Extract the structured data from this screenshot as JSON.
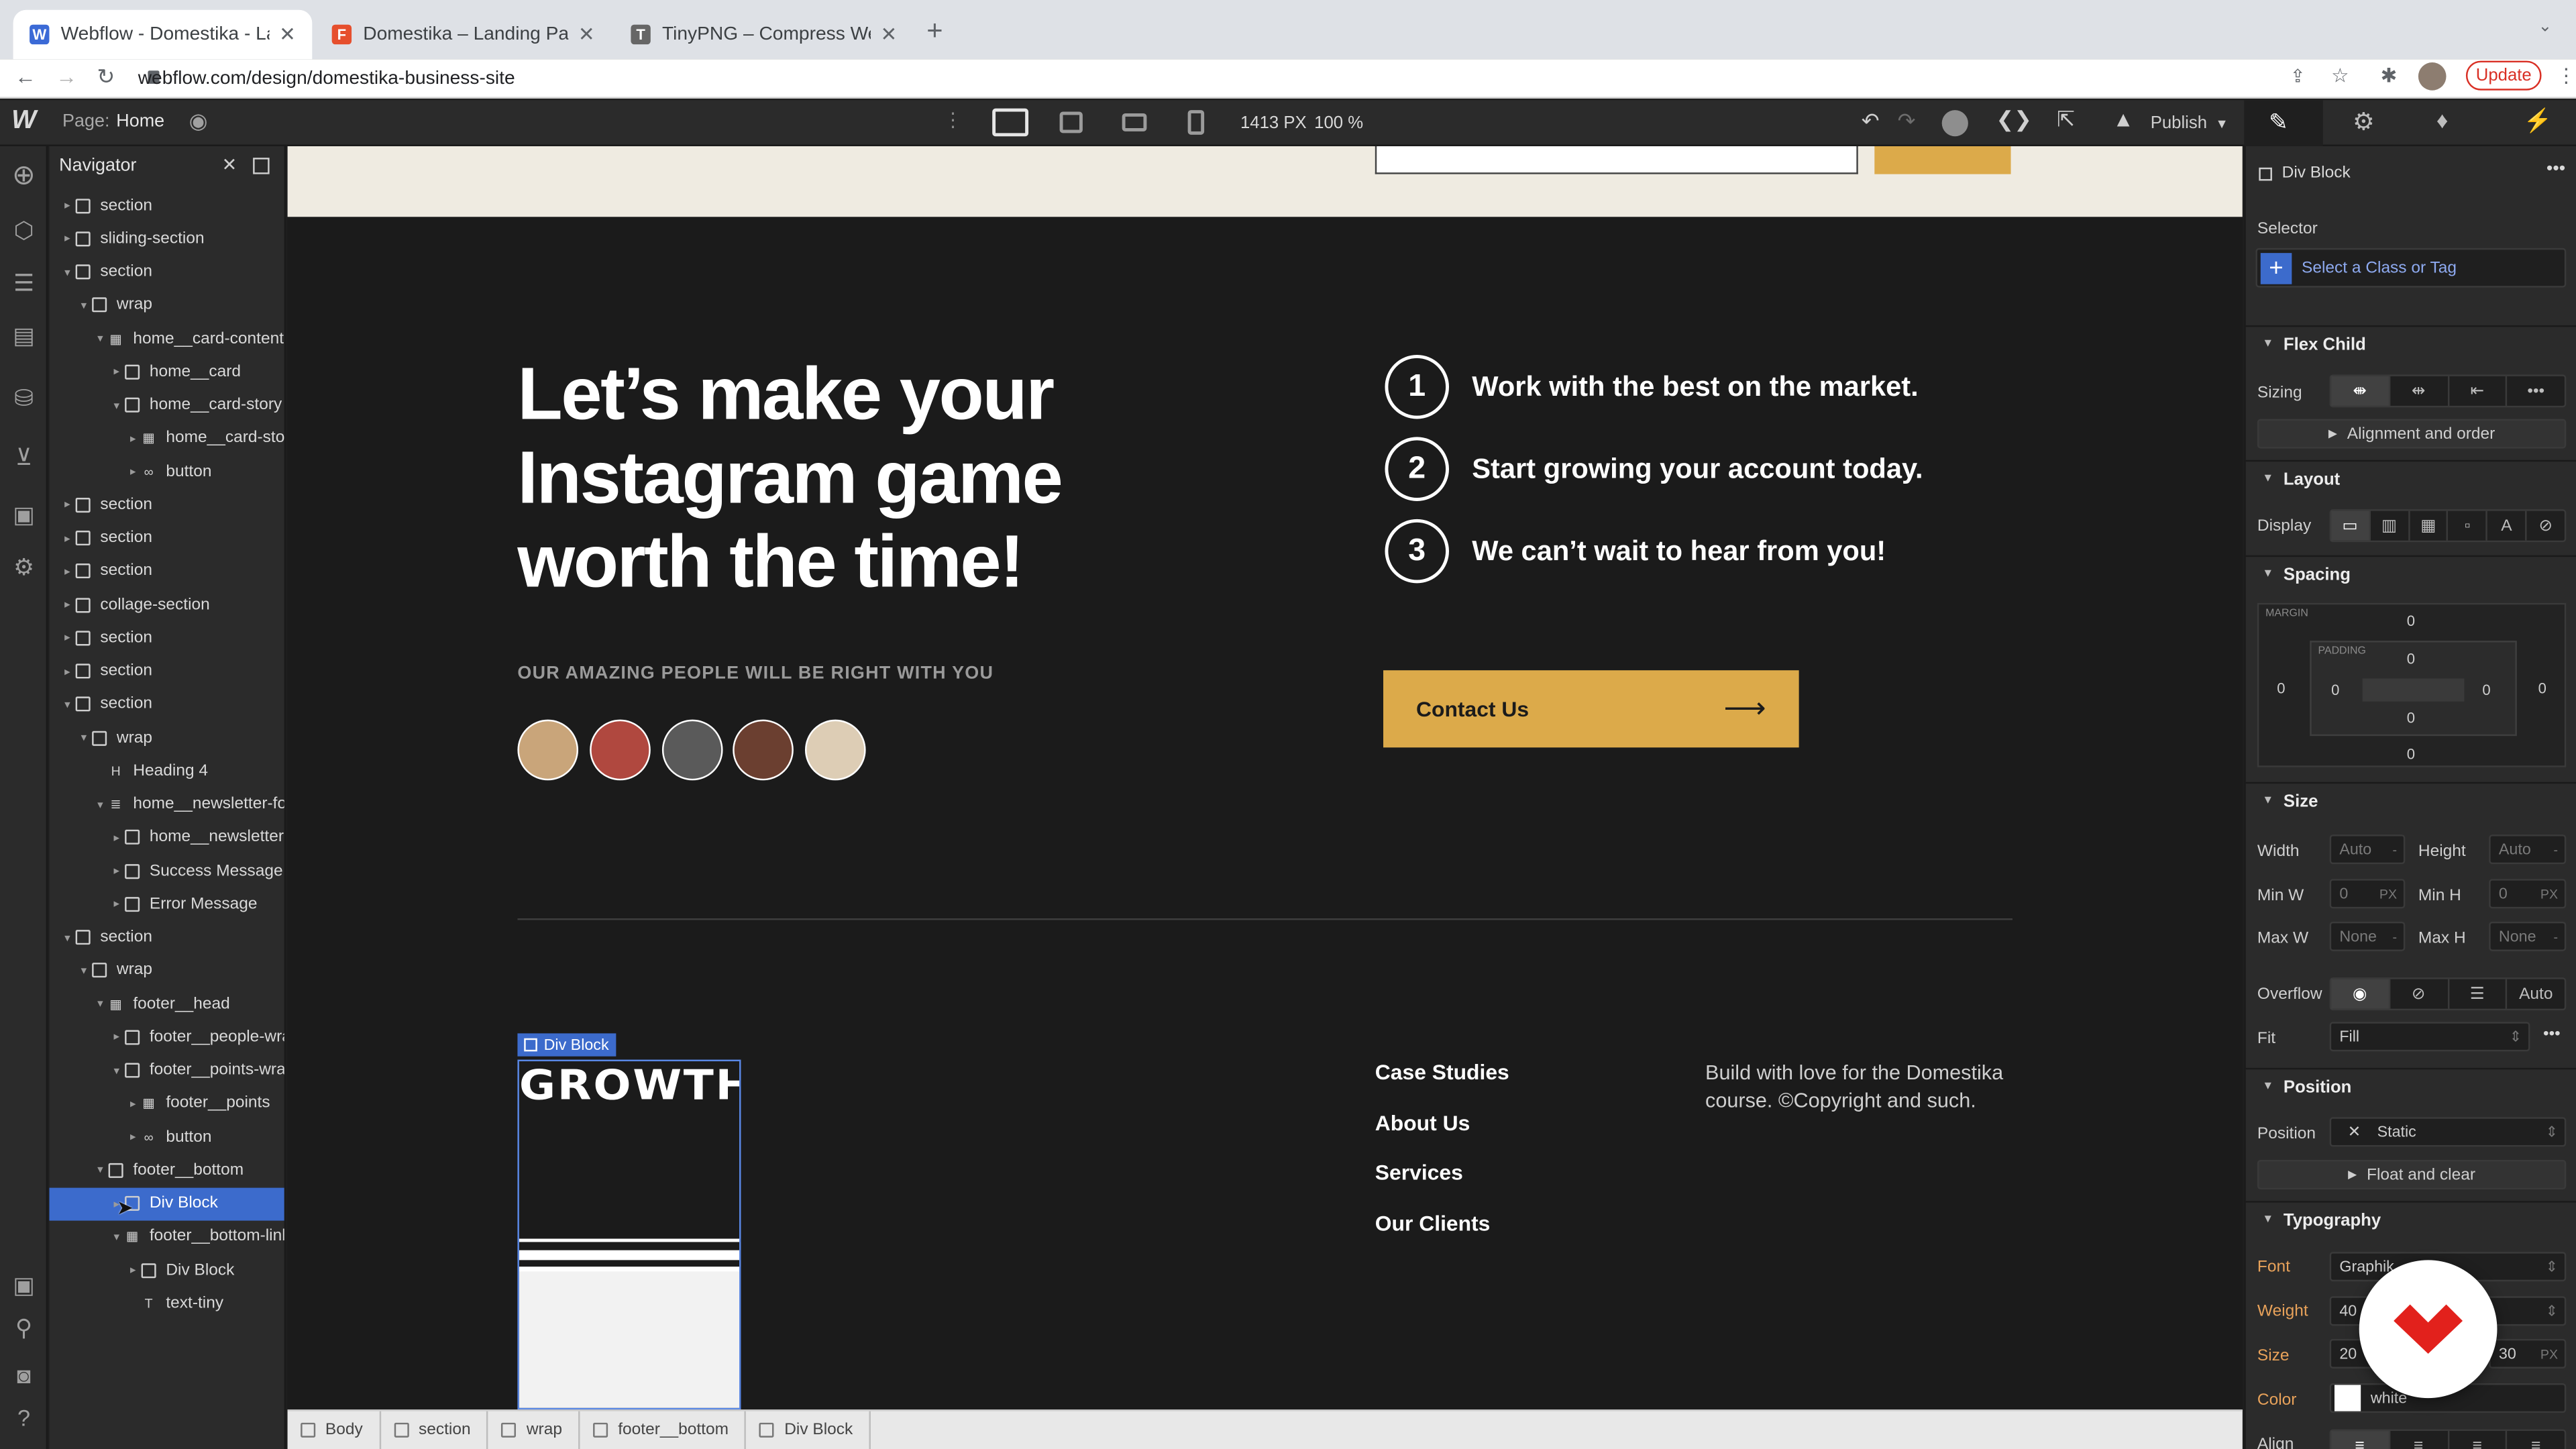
{
  "browser": {
    "tabs": [
      {
        "title": "Webflow - Domestika - Landin",
        "icon": "W",
        "color": "#3b6ad6"
      },
      {
        "title": "Domestika – Landing Page – Fi",
        "icon": "F",
        "color": "#e64f2d"
      },
      {
        "title": "TinyPNG – Compress WebP, P",
        "icon": "T",
        "color": "#555"
      }
    ],
    "url": "webflow.com/design/domestika-business-site",
    "update_label": "Update"
  },
  "topbar": {
    "page_label": "Page:",
    "page_name": "Home",
    "canvas_width": "1413 PX",
    "zoom": "100 %",
    "publish": "Publish"
  },
  "navigator": {
    "title": "Navigator",
    "items": [
      {
        "label": "section",
        "indent": 0,
        "caret": "▸",
        "icon": "box"
      },
      {
        "label": "sliding-section",
        "indent": 0,
        "caret": "▸",
        "icon": "box"
      },
      {
        "label": "section",
        "indent": 0,
        "caret": "▾",
        "icon": "box"
      },
      {
        "label": "wrap",
        "indent": 1,
        "caret": "▾",
        "icon": "box"
      },
      {
        "label": "home__card-content",
        "indent": 2,
        "caret": "▾",
        "icon": "grid"
      },
      {
        "label": "home__card",
        "indent": 3,
        "caret": "▸",
        "icon": "box"
      },
      {
        "label": "home__card-story",
        "indent": 3,
        "caret": "▾",
        "icon": "box"
      },
      {
        "label": "home__card-stor",
        "indent": 4,
        "caret": "▸",
        "icon": "grid"
      },
      {
        "label": "button",
        "indent": 4,
        "caret": "▸",
        "icon": "link"
      },
      {
        "label": "section",
        "indent": 0,
        "caret": "▸",
        "icon": "box"
      },
      {
        "label": "section",
        "indent": 0,
        "caret": "▸",
        "icon": "box"
      },
      {
        "label": "section",
        "indent": 0,
        "caret": "▸",
        "icon": "box"
      },
      {
        "label": "collage-section",
        "indent": 0,
        "caret": "▸",
        "icon": "box"
      },
      {
        "label": "section",
        "indent": 0,
        "caret": "▸",
        "icon": "box"
      },
      {
        "label": "section",
        "indent": 0,
        "caret": "▸",
        "icon": "box"
      },
      {
        "label": "section",
        "indent": 0,
        "caret": "▾",
        "icon": "box"
      },
      {
        "label": "wrap",
        "indent": 1,
        "caret": "▾",
        "icon": "box"
      },
      {
        "label": "Heading 4",
        "indent": 2,
        "caret": "",
        "icon": "heading"
      },
      {
        "label": "home__newsletter-for",
        "indent": 2,
        "caret": "▾",
        "icon": "form"
      },
      {
        "label": "home__newsletter-",
        "indent": 3,
        "caret": "▸",
        "icon": "box"
      },
      {
        "label": "Success Message",
        "indent": 3,
        "caret": "▸",
        "icon": "box"
      },
      {
        "label": "Error Message",
        "indent": 3,
        "caret": "▸",
        "icon": "box"
      },
      {
        "label": "section",
        "indent": 0,
        "caret": "▾",
        "icon": "box"
      },
      {
        "label": "wrap",
        "indent": 1,
        "caret": "▾",
        "icon": "box"
      },
      {
        "label": "footer__head",
        "indent": 2,
        "caret": "▾",
        "icon": "grid"
      },
      {
        "label": "footer__people-wra",
        "indent": 3,
        "caret": "▸",
        "icon": "box"
      },
      {
        "label": "footer__points-wrap",
        "indent": 3,
        "caret": "▾",
        "icon": "box"
      },
      {
        "label": "footer__points",
        "indent": 4,
        "caret": "▸",
        "icon": "grid"
      },
      {
        "label": "button",
        "indent": 4,
        "caret": "▸",
        "icon": "link"
      },
      {
        "label": "footer__bottom",
        "indent": 2,
        "caret": "▾",
        "icon": "box"
      },
      {
        "label": "Div Block",
        "indent": 3,
        "caret": "▸",
        "icon": "box",
        "selected": true
      },
      {
        "label": "footer__bottom-link",
        "indent": 3,
        "caret": "▾",
        "icon": "grid"
      },
      {
        "label": "Div Block",
        "indent": 4,
        "caret": "▸",
        "icon": "box"
      },
      {
        "label": "text-tiny",
        "indent": 4,
        "caret": "",
        "icon": "text"
      }
    ]
  },
  "canvas": {
    "headline_lines": [
      "Let’s make your",
      "Instagram game",
      "worth the time!"
    ],
    "people_caption": "OUR AMAZING PEOPLE WILL BE RIGHT WITH YOU",
    "points": [
      {
        "num": "1",
        "text": "Work with the best on the market."
      },
      {
        "num": "2",
        "text": "Start growing your account today."
      },
      {
        "num": "3",
        "text": "We can’t wait to hear from you!"
      }
    ],
    "cta_label": "Contact Us",
    "selection_tag": "Div Block",
    "logo_text": "GROWTH",
    "footer_links": [
      "Case Studies",
      "About Us",
      "Services",
      "Our Clients"
    ],
    "footer_note": "Build with love for the Domestika course. ©Copyright and such.",
    "accent": "#dcaa4a"
  },
  "breadcrumbs": [
    "Body",
    "section",
    "wrap",
    "footer__bottom",
    "Div Block"
  ],
  "panel": {
    "element_name": "Div Block",
    "selector_label": "Selector",
    "selector_placeholder": "Select a Class or Tag",
    "flex_child": "Flex Child",
    "sizing_label": "Sizing",
    "alignment_label": "Alignment and order",
    "layout": "Layout",
    "display_label": "Display",
    "spacing": "Spacing",
    "margin_label": "MARGIN",
    "padding_label": "PADDING",
    "zero": "0",
    "size": "Size",
    "width_label": "Width",
    "height_label": "Height",
    "minw_label": "Min W",
    "minh_label": "Min H",
    "maxw_label": "Max W",
    "maxh_label": "Max H",
    "auto": "Auto",
    "none": "None",
    "px": "PX",
    "dash": "-",
    "overflow_label": "Overflow",
    "overflow_auto": "Auto",
    "fit_label": "Fit",
    "fit_value": "Fill",
    "position": "Position",
    "position_label": "Position",
    "position_value": "Static",
    "float_label": "Float and clear",
    "typography": "Typography",
    "font_label": "Font",
    "font_value": "Graphik",
    "weight_label": "Weight",
    "weight_value": "40",
    "size_label": "Size",
    "size_value": "20",
    "lh_value": "30",
    "color_label": "Color",
    "color_value": "white",
    "align_label": "Align"
  }
}
